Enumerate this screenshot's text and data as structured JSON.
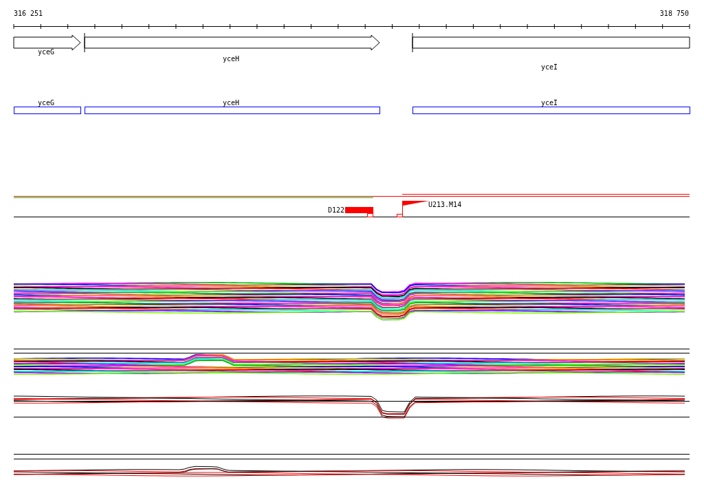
{
  "ruler": {
    "start": "316 251",
    "end": "318 750"
  },
  "genes": [
    {
      "name": "yceG",
      "kind": "arrow"
    },
    {
      "name": "yceH",
      "kind": "arrow"
    },
    {
      "name": "yceI",
      "kind": "box"
    }
  ],
  "annotations": [
    {
      "name": "yceG"
    },
    {
      "name": "yceH"
    },
    {
      "name": "yceI"
    }
  ],
  "features": [
    {
      "label": "D122",
      "kind": "block"
    },
    {
      "label": "U213.M14",
      "kind": "flag"
    }
  ]
}
